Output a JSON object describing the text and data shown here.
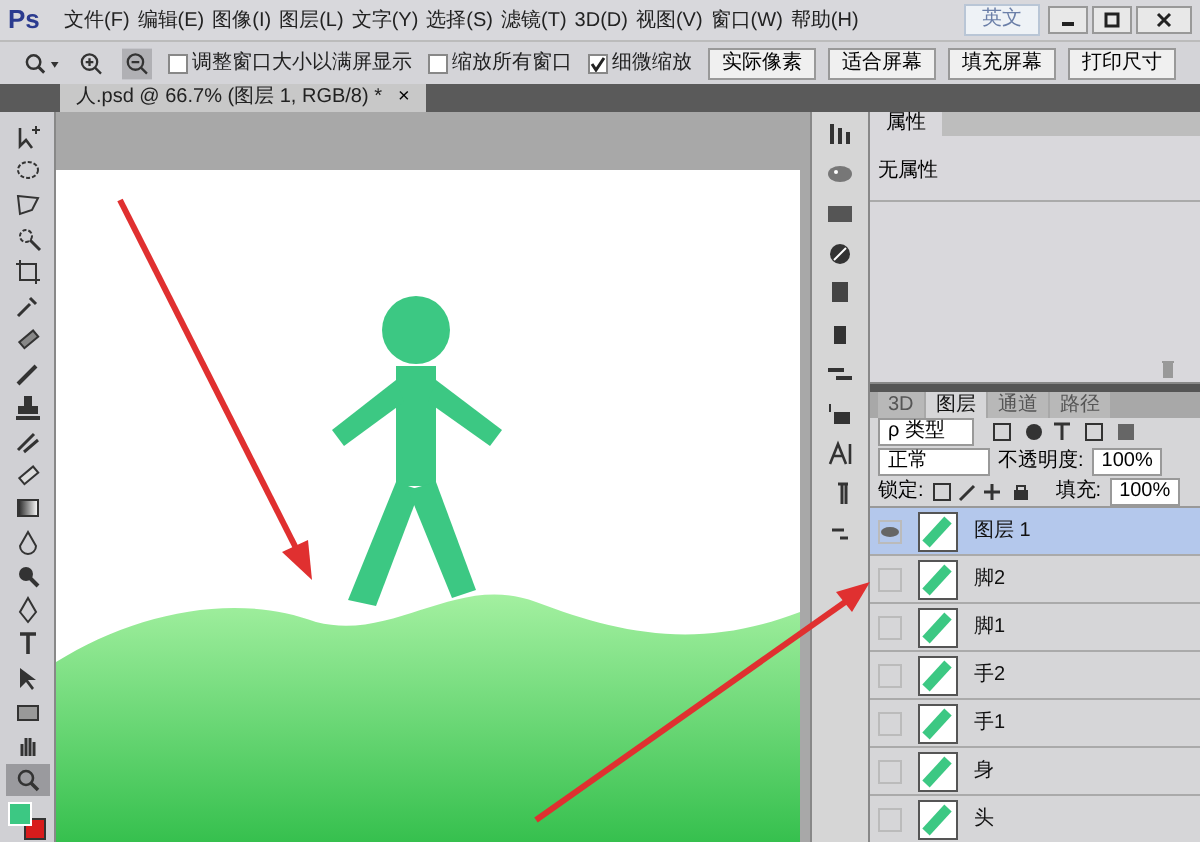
{
  "app": {
    "logo": "Ps",
    "menus": [
      "文件(F)",
      "编辑(E)",
      "图像(I)",
      "图层(L)",
      "文字(Y)",
      "选择(S)",
      "滤镜(T)",
      "3D(D)",
      "视图(V)",
      "窗口(W)",
      "帮助(H)"
    ],
    "ime_badge": "英文"
  },
  "options_bar": {
    "checkboxes": [
      {
        "label": "调整窗口大小以满屏显示",
        "checked": false
      },
      {
        "label": "缩放所有窗口",
        "checked": false
      },
      {
        "label": "细微缩放",
        "checked": true
      }
    ],
    "buttons": [
      "实际像素",
      "适合屏幕",
      "填充屏幕",
      "打印尺寸"
    ]
  },
  "document_tab": {
    "title": "人.psd @ 66.7% (图层 1, RGB/8) *",
    "close": "×"
  },
  "tools": [
    {
      "selected": false
    },
    {
      "selected": false
    },
    {
      "selected": false
    },
    {
      "selected": false
    },
    {
      "selected": false
    },
    {
      "selected": false
    },
    {
      "selected": false
    },
    {
      "selected": false
    },
    {
      "selected": false
    },
    {
      "selected": false
    },
    {
      "selected": false
    },
    {
      "selected": false
    },
    {
      "selected": false
    },
    {
      "selected": false
    },
    {
      "selected": false
    },
    {
      "selected": false
    },
    {
      "selected": false
    },
    {
      "selected": false
    },
    {
      "selected": false
    },
    {
      "selected": true
    }
  ],
  "properties_panel": {
    "tab": "属性",
    "text": "无属性"
  },
  "layers_panel": {
    "tabs": [
      {
        "label": "3D",
        "selected": false
      },
      {
        "label": "图层",
        "selected": true
      },
      {
        "label": "通道",
        "selected": false
      },
      {
        "label": "路径",
        "selected": false
      }
    ],
    "filter": "ρ 类型",
    "blend_mode": "正常",
    "opacity_label": "不透明度:",
    "opacity": "100%",
    "lock_label": "锁定:",
    "fill_label": "填充:",
    "fill": "100%",
    "layers": [
      {
        "name": "图层 1",
        "visible": true,
        "selected": true
      },
      {
        "name": "脚2",
        "visible": false,
        "selected": false
      },
      {
        "name": "脚1",
        "visible": false,
        "selected": false
      },
      {
        "name": "手2",
        "visible": false,
        "selected": false
      },
      {
        "name": "手1",
        "visible": false,
        "selected": false
      },
      {
        "name": "身",
        "visible": false,
        "selected": false
      },
      {
        "name": "头",
        "visible": false,
        "selected": false
      }
    ]
  }
}
